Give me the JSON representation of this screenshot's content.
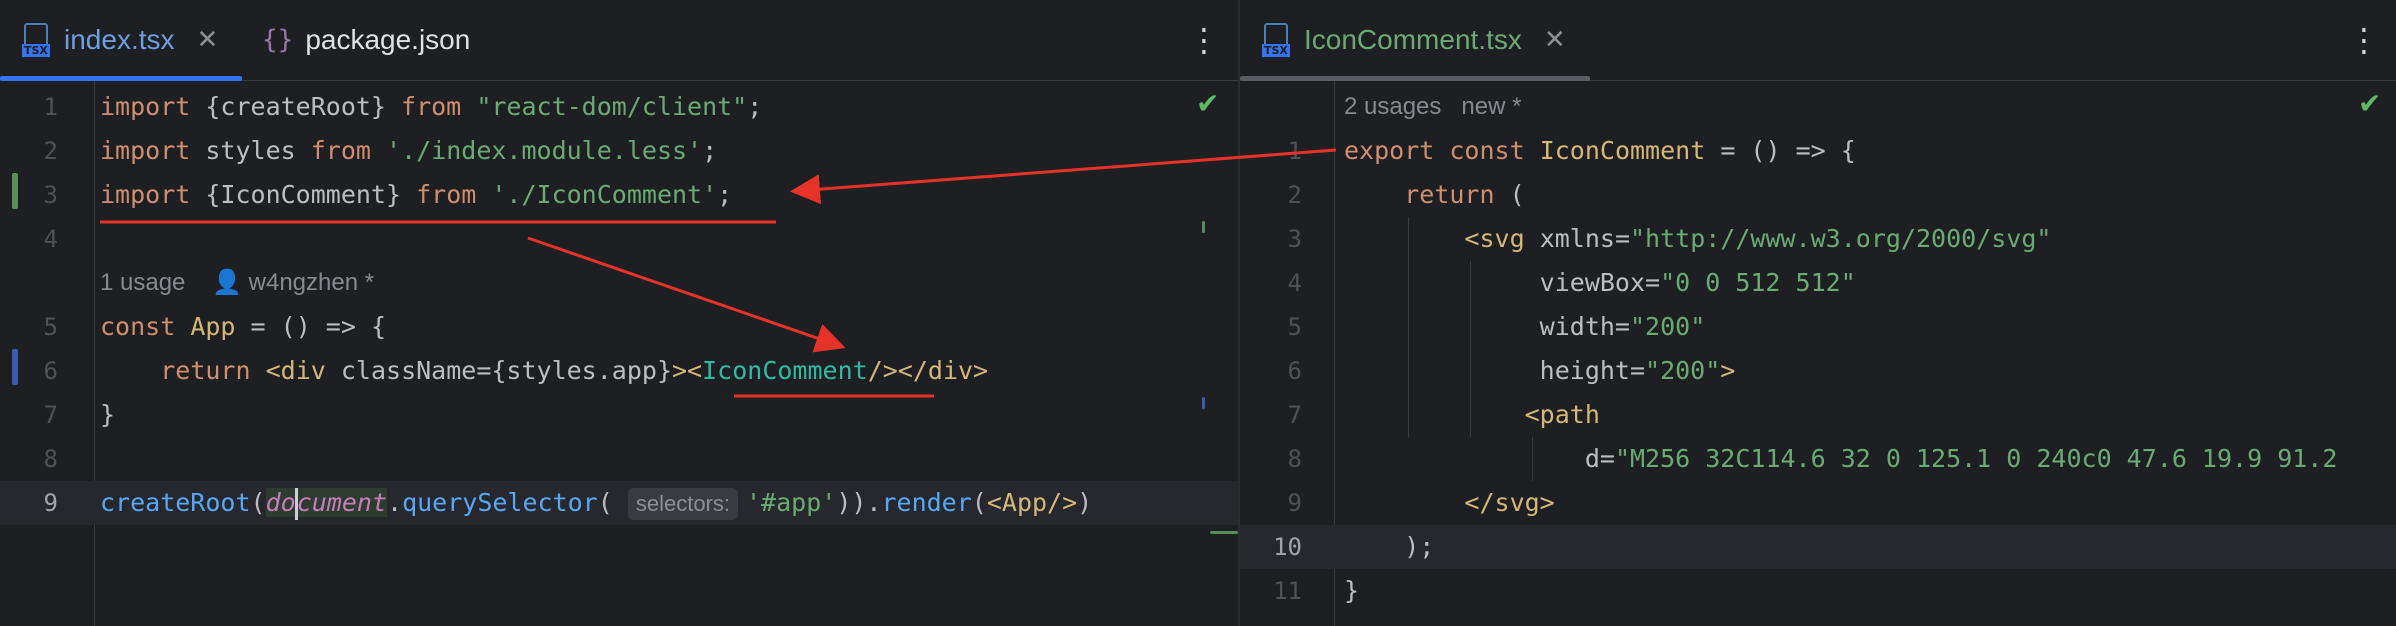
{
  "colors": {
    "accent": "#3574f0",
    "keyword": "#cf8e6d",
    "string": "#6aab73",
    "tag": "#d5b778",
    "component": "#2fbaa3",
    "annotation": "#e5332a",
    "added_marker": "#549159",
    "modified_marker": "#375fad"
  },
  "left": {
    "tabs": [
      {
        "label": "index.tsx",
        "icon": "tsx-file-icon",
        "active": true
      },
      {
        "label": "package.json",
        "icon": "json-file-icon",
        "active": false
      }
    ],
    "usages_hint": "1 usage",
    "author_hint": "w4ngzhen *",
    "inlay_hint": "selectors:",
    "lines": [
      {
        "n": "1",
        "text": "import {createRoot} from \"react-dom/client\";"
      },
      {
        "n": "2",
        "text": "import styles from './index.module.less';"
      },
      {
        "n": "3",
        "text": "import {IconComment} from './IconComment';"
      },
      {
        "n": "4",
        "text": ""
      },
      {
        "n": "5",
        "text": "const App = () => {"
      },
      {
        "n": "6",
        "text": "    return <div className={styles.app}><IconComment/></div>"
      },
      {
        "n": "7",
        "text": "}"
      },
      {
        "n": "8",
        "text": ""
      },
      {
        "n": "9",
        "text": "createRoot(document.querySelector( '#app')).render(<App/>)"
      }
    ]
  },
  "right": {
    "tabs": [
      {
        "label": "IconComment.tsx",
        "icon": "tsx-file-icon",
        "active": true
      }
    ],
    "usages_hint": "2 usages",
    "new_hint": "new *",
    "lines": [
      {
        "n": "1",
        "text": "export const IconComment = () => {"
      },
      {
        "n": "2",
        "text": "    return ("
      },
      {
        "n": "3",
        "text": "        <svg xmlns=\"http://www.w3.org/2000/svg\""
      },
      {
        "n": "4",
        "text": "             viewBox=\"0 0 512 512\""
      },
      {
        "n": "5",
        "text": "             width=\"200\""
      },
      {
        "n": "6",
        "text": "             height=\"200\">"
      },
      {
        "n": "7",
        "text": "            <path"
      },
      {
        "n": "8",
        "text": "                d=\"M256 32C114.6 32 0 125.1 0 240c0 47.6 19.9 91.2"
      },
      {
        "n": "9",
        "text": "        </svg>"
      },
      {
        "n": "10",
        "text": "    );"
      },
      {
        "n": "11",
        "text": "}"
      }
    ]
  }
}
